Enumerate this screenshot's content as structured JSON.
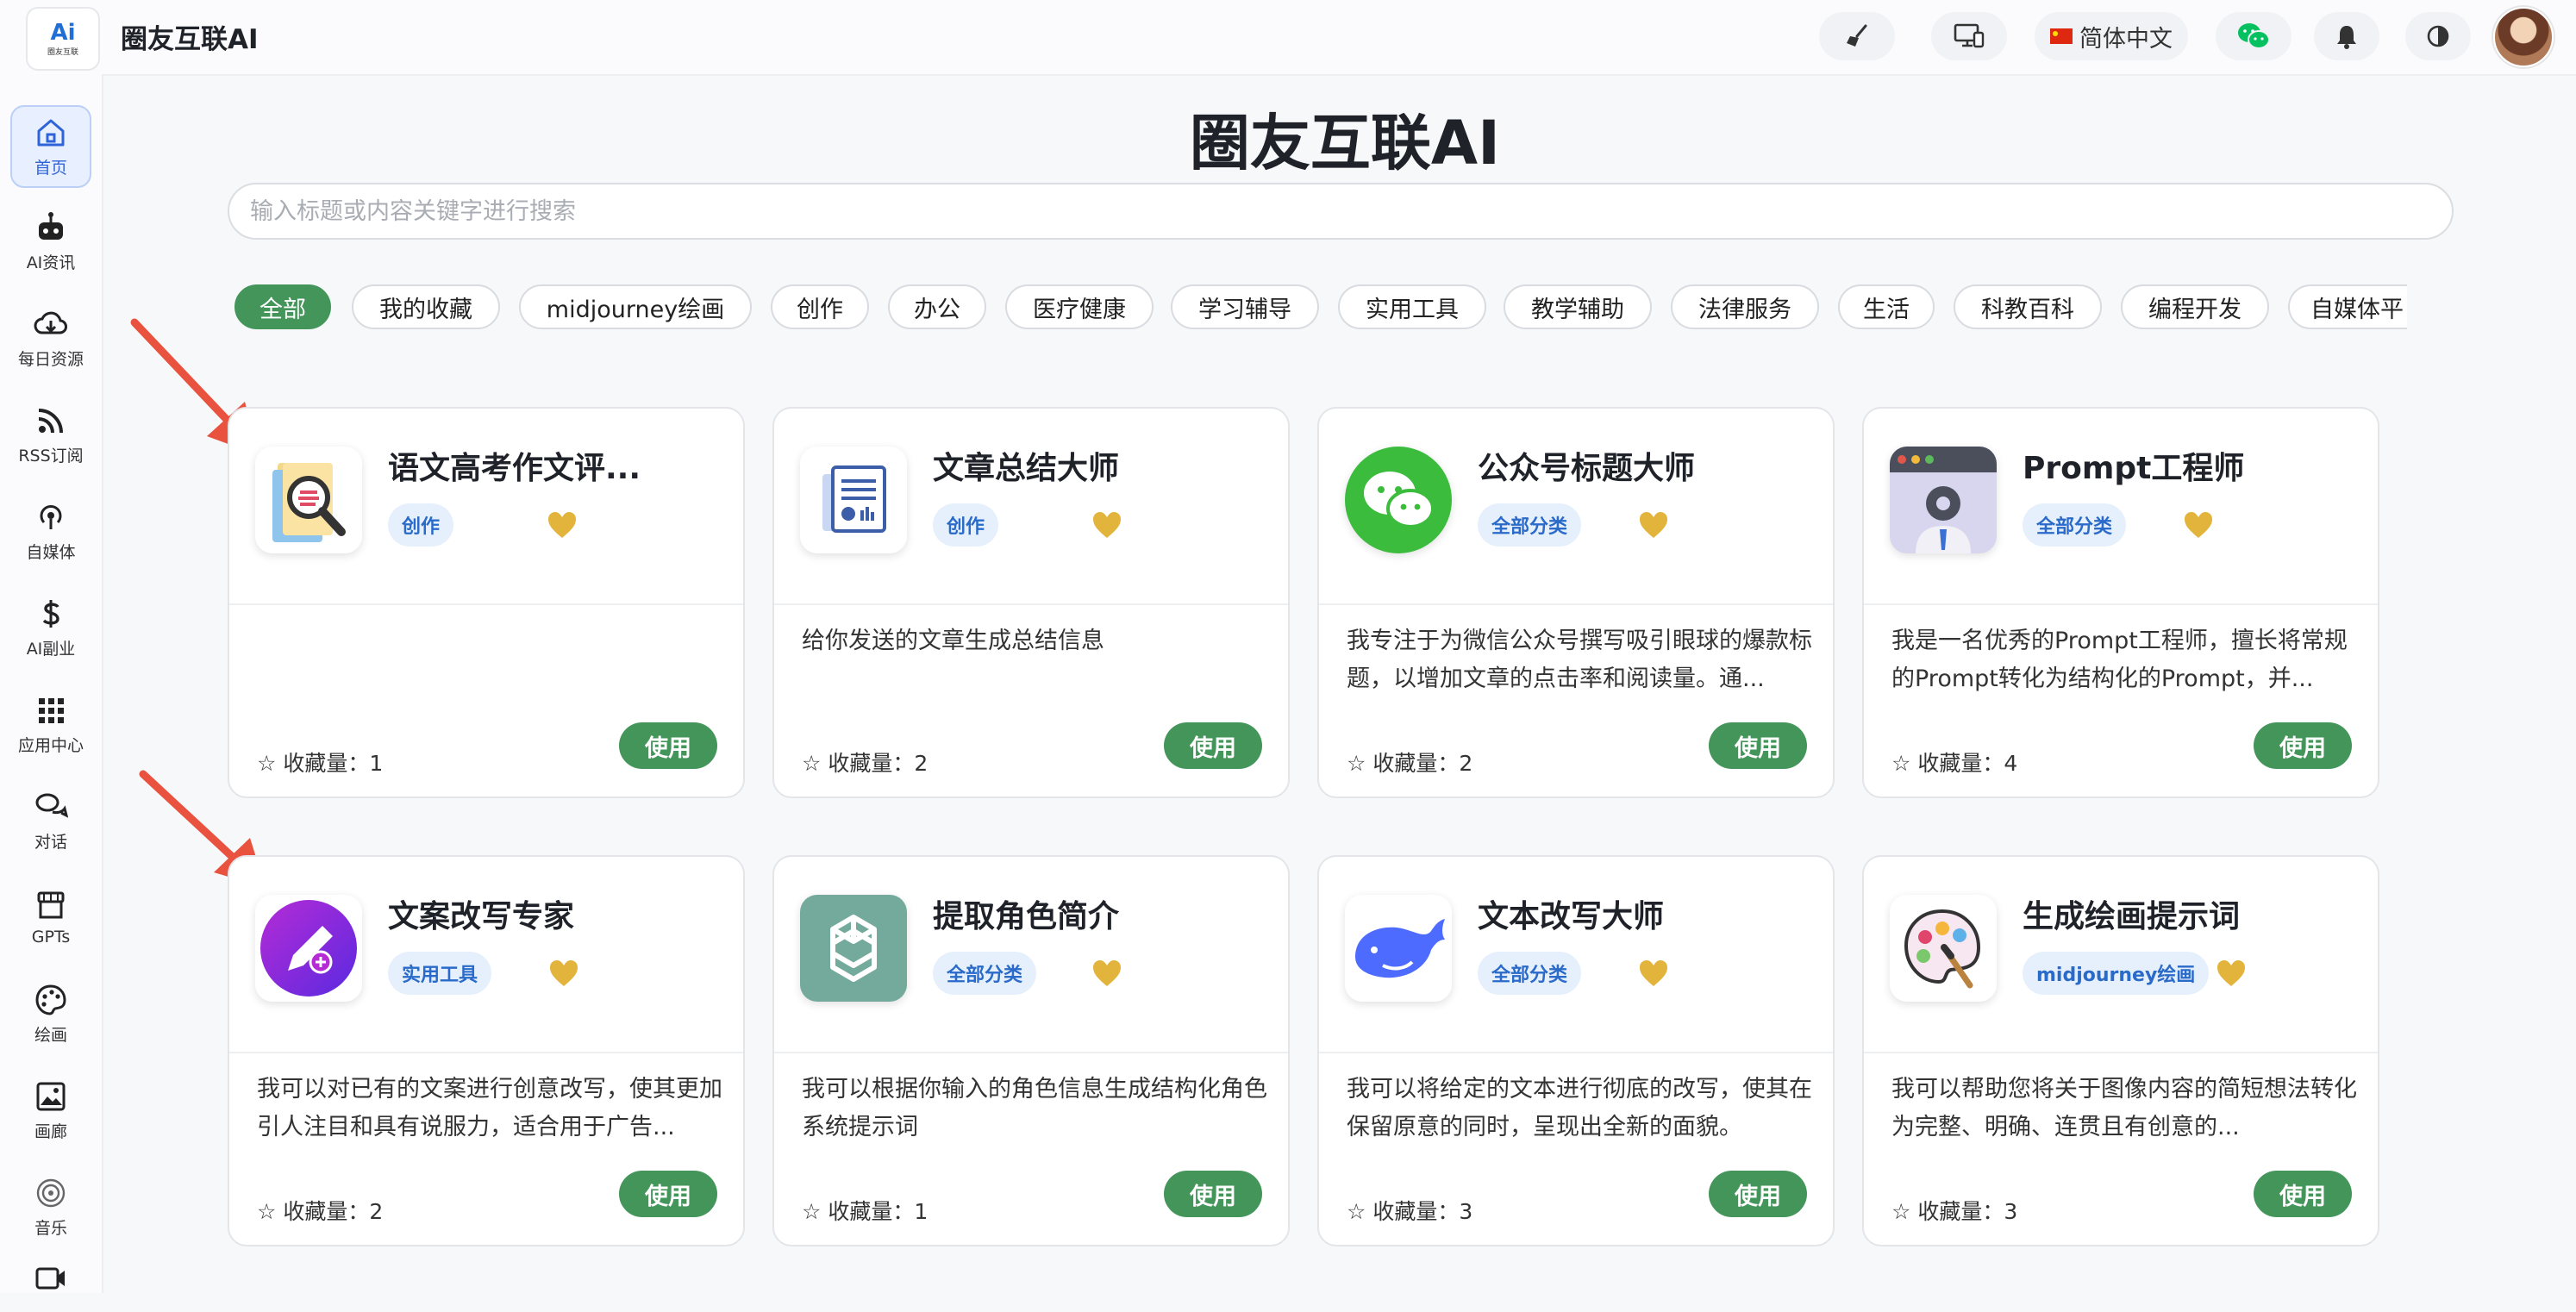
{
  "header": {
    "logo_text": "Ai",
    "logo_sub": "圈友互联",
    "app_title": "圈友互联AI",
    "language_label": "简体中文",
    "tools": [
      {
        "icon": "broom-icon"
      },
      {
        "icon": "monitor-icon"
      },
      {
        "icon": "flag-cn-icon"
      },
      {
        "icon": "wechat-icon"
      },
      {
        "icon": "bell-icon"
      },
      {
        "icon": "theme-toggle-icon"
      }
    ]
  },
  "sidebar": {
    "items": [
      {
        "label": "首页",
        "icon": "home-icon",
        "active": true
      },
      {
        "label": "AI资讯",
        "icon": "robot-icon"
      },
      {
        "label": "每日资源",
        "icon": "cloud-download-icon"
      },
      {
        "label": "RSS订阅",
        "icon": "rss-icon"
      },
      {
        "label": "自媒体",
        "icon": "podcast-icon"
      },
      {
        "label": "AI副业",
        "icon": "dollar-icon"
      },
      {
        "label": "应用中心",
        "icon": "grid-icon"
      },
      {
        "label": "对话",
        "icon": "chat-icon"
      },
      {
        "label": "GPTs",
        "icon": "store-icon"
      },
      {
        "label": "绘画",
        "icon": "palette-icon"
      },
      {
        "label": "画廊",
        "icon": "image-icon"
      },
      {
        "label": "音乐",
        "icon": "music-icon"
      },
      {
        "label": "",
        "icon": "video-icon"
      }
    ]
  },
  "main": {
    "title": "圈友互联AI",
    "search_placeholder": "输入标题或内容关键字进行搜索",
    "categories": [
      "全部",
      "我的收藏",
      "midjourney绘画",
      "创作",
      "办公",
      "医疗健康",
      "学习辅导",
      "实用工具",
      "教学辅助",
      "法律服务",
      "生活",
      "科教百科",
      "编程开发",
      "自媒体平"
    ],
    "active_category": "全部",
    "favorites_label": "收藏量：",
    "use_label": "使用",
    "cards": [
      {
        "title": "语文高考作文评...",
        "tag": "创作",
        "description": "",
        "favorites": "1",
        "icon": "essay-review-icon"
      },
      {
        "title": "文章总结大师",
        "tag": "创作",
        "description": "给你发送的文章生成总结信息",
        "favorites": "2",
        "icon": "document-chart-icon"
      },
      {
        "title": "公众号标题大师",
        "tag": "全部分类",
        "description": "我专注于为微信公众号撰写吸引眼球的爆款标题，以增加文章的点击率和阅读量。通...",
        "favorites": "2",
        "icon": "wechat-icon"
      },
      {
        "title": "Prompt工程师",
        "tag": "全部分类",
        "description": "我是一名优秀的Prompt工程师，擅长将常规的Prompt转化为结构化的Prompt，并...",
        "favorites": "4",
        "icon": "engineer-icon"
      },
      {
        "title": "文案改写专家",
        "tag": "实用工具",
        "description": "我可以对已有的文案进行创意改写，使其更加引人注目和具有说服力，适合用于广告...",
        "favorites": "2",
        "icon": "pen-edit-icon"
      },
      {
        "title": "提取角色简介",
        "tag": "全部分类",
        "description": "我可以根据你输入的角色信息生成结构化角色系统提示词",
        "favorites": "1",
        "icon": "openai-icon"
      },
      {
        "title": "文本改写大师",
        "tag": "全部分类",
        "description": "我可以将给定的文本进行彻底的改写，使其在保留原意的同时，呈现出全新的面貌。",
        "favorites": "3",
        "icon": "whale-icon"
      },
      {
        "title": "生成绘画提示词",
        "tag": "midjourney绘画",
        "description": "我可以帮助您将关于图像内容的简短想法转化为完整、明确、连贯且有创意的...",
        "favorites": "3",
        "icon": "palette-icon"
      }
    ]
  },
  "colors": {
    "accent_green": "#43955a",
    "tag_blue": "#2a6ac8",
    "heart_gold": "#e2b43c",
    "arrow_red": "#e8523f"
  }
}
